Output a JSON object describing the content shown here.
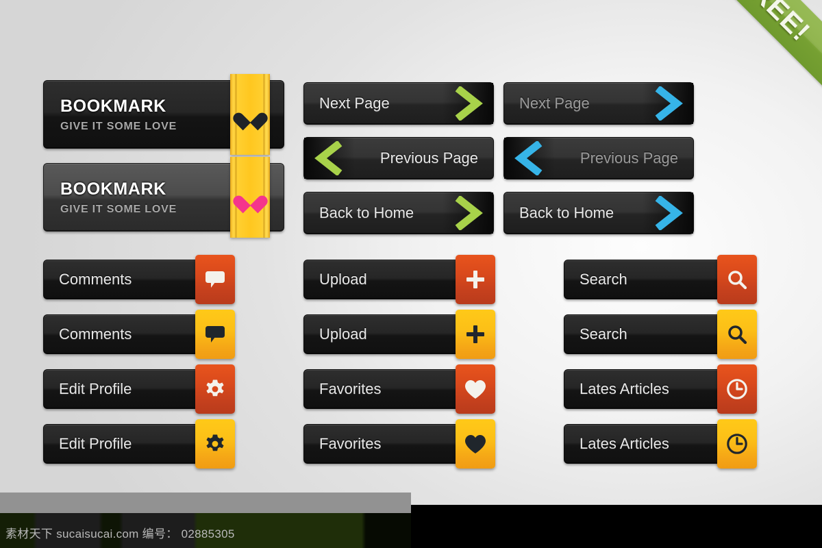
{
  "ribbon": {
    "label": "FREE!",
    "color": "#85ad3c"
  },
  "colors": {
    "background": "#e2e2e2",
    "button_dark": "#1a1a1a",
    "button_light": "#4c4c4c",
    "tab_red": "#d9491c",
    "tab_yellow": "#fcc017",
    "strip_yellow": "#ffc71f",
    "chevron_green": "#a8d24a",
    "chevron_blue": "#36b4e8",
    "heart_pink": "#f5358c",
    "heart_dark": "#1f2328"
  },
  "bookmark_buttons": [
    {
      "title": "BOOKMARK",
      "subtitle": "GIVE IT SOME LOVE",
      "style": "dark",
      "heart_color": "dark",
      "icon": "heart-icon"
    },
    {
      "title": "BOOKMARK",
      "subtitle": "GIVE IT SOME LOVE",
      "style": "light",
      "heart_color": "pink",
      "icon": "heart-icon"
    }
  ],
  "nav_buttons": [
    {
      "label": "Next Page",
      "direction": "right",
      "accent": "green",
      "icon": "chevron-right-icon",
      "label_tone": "bright"
    },
    {
      "label": "Previous Page",
      "direction": "left",
      "accent": "green",
      "icon": "chevron-left-icon",
      "label_tone": "bright"
    },
    {
      "label": "Back to Home",
      "direction": "right",
      "accent": "green",
      "icon": "chevron-right-icon",
      "label_tone": "bright"
    },
    {
      "label": "Next Page",
      "direction": "right",
      "accent": "blue",
      "icon": "chevron-right-icon",
      "label_tone": "dim"
    },
    {
      "label": "Previous Page",
      "direction": "left",
      "accent": "blue",
      "icon": "chevron-left-icon",
      "label_tone": "dim"
    },
    {
      "label": "Back to Home",
      "direction": "right",
      "accent": "blue",
      "icon": "chevron-right-icon",
      "label_tone": "bright"
    }
  ],
  "icon_buttons": [
    {
      "label": "Comments",
      "icon": "speech-bubble-icon",
      "tab": "red",
      "glyph": "light"
    },
    {
      "label": "Comments",
      "icon": "speech-bubble-icon",
      "tab": "yellow",
      "glyph": "dark"
    },
    {
      "label": "Edit Profile",
      "icon": "gear-icon",
      "tab": "red",
      "glyph": "light"
    },
    {
      "label": "Edit Profile",
      "icon": "gear-icon",
      "tab": "yellow",
      "glyph": "dark"
    },
    {
      "label": "Upload",
      "icon": "plus-icon",
      "tab": "red",
      "glyph": "light"
    },
    {
      "label": "Upload",
      "icon": "plus-icon",
      "tab": "yellow",
      "glyph": "dark"
    },
    {
      "label": "Favorites",
      "icon": "heart-icon",
      "tab": "red",
      "glyph": "light"
    },
    {
      "label": "Favorites",
      "icon": "heart-icon",
      "tab": "yellow",
      "glyph": "dark"
    },
    {
      "label": "Search",
      "icon": "search-icon",
      "tab": "red",
      "glyph": "light"
    },
    {
      "label": "Search",
      "icon": "search-icon",
      "tab": "yellow",
      "glyph": "dark"
    },
    {
      "label": "Lates Articles",
      "icon": "clock-icon",
      "tab": "red",
      "glyph": "light"
    },
    {
      "label": "Lates Articles",
      "icon": "clock-icon",
      "tab": "yellow",
      "glyph": "dark"
    }
  ],
  "watermark": {
    "text": "素材天下 sucaisucai.com  编号： 02885305",
    "site": "sucaisucai.com",
    "id": "02885305"
  }
}
